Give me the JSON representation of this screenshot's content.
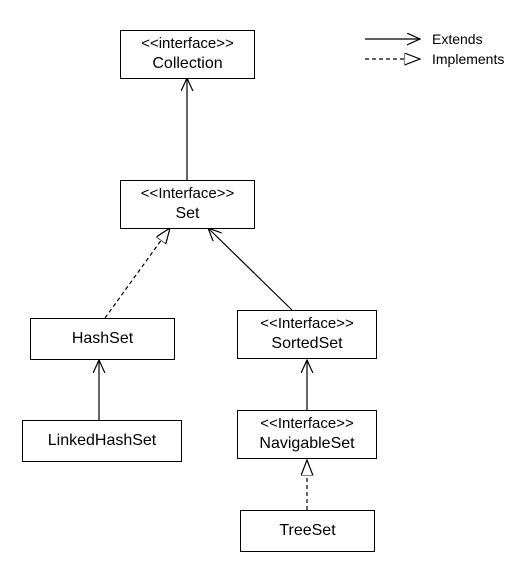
{
  "nodes": {
    "collection": {
      "stereotype": "<<interface>>",
      "name": "Collection"
    },
    "set": {
      "stereotype": "<<Interface>>",
      "name": "Set"
    },
    "hashset": {
      "stereotype": "",
      "name": "HashSet"
    },
    "sortedset": {
      "stereotype": "<<Interface>>",
      "name": "SortedSet"
    },
    "linkedhashset": {
      "stereotype": "",
      "name": "LinkedHashSet"
    },
    "navigableset": {
      "stereotype": "<<Interface>>",
      "name": "NavigableSet"
    },
    "treeset": {
      "stereotype": "",
      "name": "TreeSet"
    }
  },
  "legend": {
    "extends": "Extends",
    "implements": "Implements"
  }
}
